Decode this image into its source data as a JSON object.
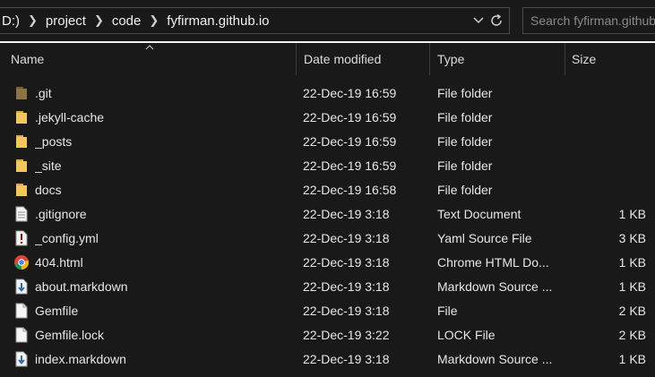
{
  "address": {
    "crumbs": [
      "D:)",
      "project",
      "code",
      "fyfirman.github.io"
    ]
  },
  "search": {
    "placeholder": "Search fyfirman.github.io"
  },
  "columns": {
    "name": "Name",
    "date": "Date modified",
    "type": "Type",
    "size": "Size"
  },
  "colors": {
    "folder": "#f3c75b",
    "background": "#191919",
    "text": "#e6e6e6"
  },
  "files": [
    {
      "name": ".git",
      "date": "22-Dec-19 16:59",
      "type": "File folder",
      "size": "",
      "icon": "folder-dim-icon"
    },
    {
      "name": ".jekyll-cache",
      "date": "22-Dec-19 16:59",
      "type": "File folder",
      "size": "",
      "icon": "folder-icon"
    },
    {
      "name": "_posts",
      "date": "22-Dec-19 16:59",
      "type": "File folder",
      "size": "",
      "icon": "folder-icon"
    },
    {
      "name": "_site",
      "date": "22-Dec-19 16:59",
      "type": "File folder",
      "size": "",
      "icon": "folder-icon"
    },
    {
      "name": "docs",
      "date": "22-Dec-19 16:58",
      "type": "File folder",
      "size": "",
      "icon": "folder-icon"
    },
    {
      "name": ".gitignore",
      "date": "22-Dec-19 3:18",
      "type": "Text Document",
      "size": "1 KB",
      "icon": "text-file-icon"
    },
    {
      "name": "_config.yml",
      "date": "22-Dec-19 3:18",
      "type": "Yaml Source File",
      "size": "3 KB",
      "icon": "yaml-file-icon"
    },
    {
      "name": "404.html",
      "date": "22-Dec-19 3:18",
      "type": "Chrome HTML Do...",
      "size": "1 KB",
      "icon": "chrome-icon"
    },
    {
      "name": "about.markdown",
      "date": "22-Dec-19 3:18",
      "type": "Markdown Source ...",
      "size": "1 KB",
      "icon": "markdown-file-icon"
    },
    {
      "name": "Gemfile",
      "date": "22-Dec-19 3:18",
      "type": "File",
      "size": "2 KB",
      "icon": "blank-file-icon"
    },
    {
      "name": "Gemfile.lock",
      "date": "22-Dec-19 3:22",
      "type": "LOCK File",
      "size": "2 KB",
      "icon": "blank-file-icon"
    },
    {
      "name": "index.markdown",
      "date": "22-Dec-19 3:18",
      "type": "Markdown Source ...",
      "size": "1 KB",
      "icon": "markdown-file-icon"
    }
  ]
}
